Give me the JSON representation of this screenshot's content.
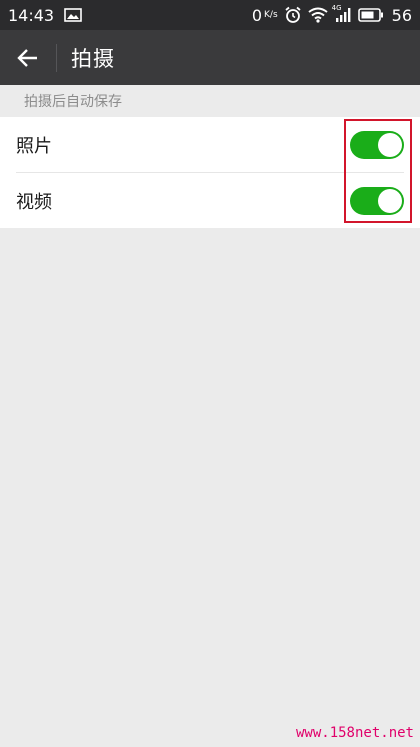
{
  "status_bar": {
    "time": "14:43",
    "net_speed": "0",
    "net_unit": "K/s",
    "network": "4G",
    "battery_level": "56"
  },
  "app_bar": {
    "title": "拍摄"
  },
  "section": {
    "header": "拍摄后自动保存"
  },
  "settings": [
    {
      "label": "照片",
      "enabled": true
    },
    {
      "label": "视频",
      "enabled": true
    }
  ],
  "colors": {
    "toggle_on": "#1aad19",
    "highlight": "#d2152b",
    "app_bar": "#3a3a3c"
  },
  "watermark": "www.158net.net"
}
